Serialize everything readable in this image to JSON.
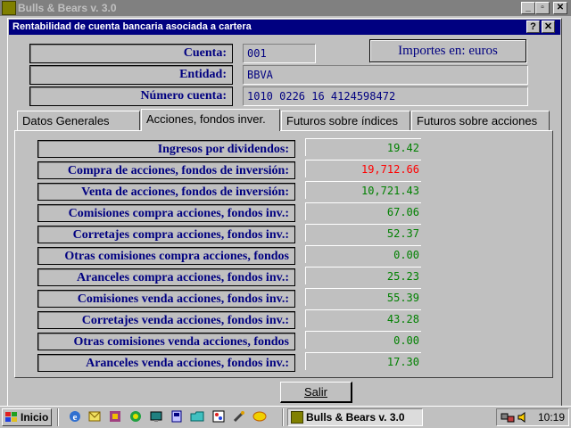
{
  "app": {
    "title": "Bulls & Bears v. 3.0"
  },
  "window_controls": {
    "minimize": "_",
    "restore": "▫",
    "close": "✕"
  },
  "dialog": {
    "title": "Rentabilidad de cuenta bancaria asociada a cartera",
    "help": "?",
    "close": "✕"
  },
  "header": {
    "cuenta_label": "Cuenta:",
    "cuenta_value": "001",
    "importes_label": "Importes en:  euros",
    "entidad_label": "Entidad:",
    "entidad_value": "BBVA",
    "numero_label": "Número cuenta:",
    "numero_value": "1010 0226 16 4124598472"
  },
  "tabs": [
    {
      "label": "Datos Generales",
      "active": false
    },
    {
      "label": "Acciones, fondos inver.",
      "active": true
    },
    {
      "label": "Futuros sobre índices",
      "active": false
    },
    {
      "label": "Futuros sobre acciones",
      "active": false
    }
  ],
  "rows": [
    {
      "label": "Ingresos por dividendos:",
      "value": "19.42",
      "color": "#008000"
    },
    {
      "label": "Compra de acciones, fondos de inversión:",
      "value": "19,712.66",
      "color": "#ff0000"
    },
    {
      "label": "Venta de acciones, fondos de inversión:",
      "value": "10,721.43",
      "color": "#008000"
    },
    {
      "label": "Comisiones compra acciones, fondos inv.:",
      "value": "67.06",
      "color": "#008000"
    },
    {
      "label": "Corretajes compra acciones, fondos inv.:",
      "value": "52.37",
      "color": "#008000"
    },
    {
      "label": "Otras comisiones compra acciones, fondos",
      "value": "0.00",
      "color": "#008000"
    },
    {
      "label": "Aranceles compra acciones, fondos inv.:",
      "value": "25.23",
      "color": "#008000"
    },
    {
      "label": "Comisiones venda acciones, fondos inv.:",
      "value": "55.39",
      "color": "#008000"
    },
    {
      "label": "Corretajes venda acciones, fondos inv.:",
      "value": "43.28",
      "color": "#008000"
    },
    {
      "label": "Otras comisiones venda acciones, fondos",
      "value": "0.00",
      "color": "#008000"
    },
    {
      "label": "Aranceles venda acciones, fondos inv.:",
      "value": "17.30",
      "color": "#008000"
    }
  ],
  "buttons": {
    "salir": "Salir"
  },
  "taskbar": {
    "start": "Inicio",
    "task": "Bulls & Bears v. 3.0",
    "clock": "10:19",
    "quicklaunch_icons": [
      "ie-icon",
      "outlook-icon",
      "media-icon",
      "channels-icon",
      "desktop-icon",
      "app-icon",
      "folder-icon",
      "paint-icon",
      "tools-icon",
      "notes-icon"
    ]
  }
}
